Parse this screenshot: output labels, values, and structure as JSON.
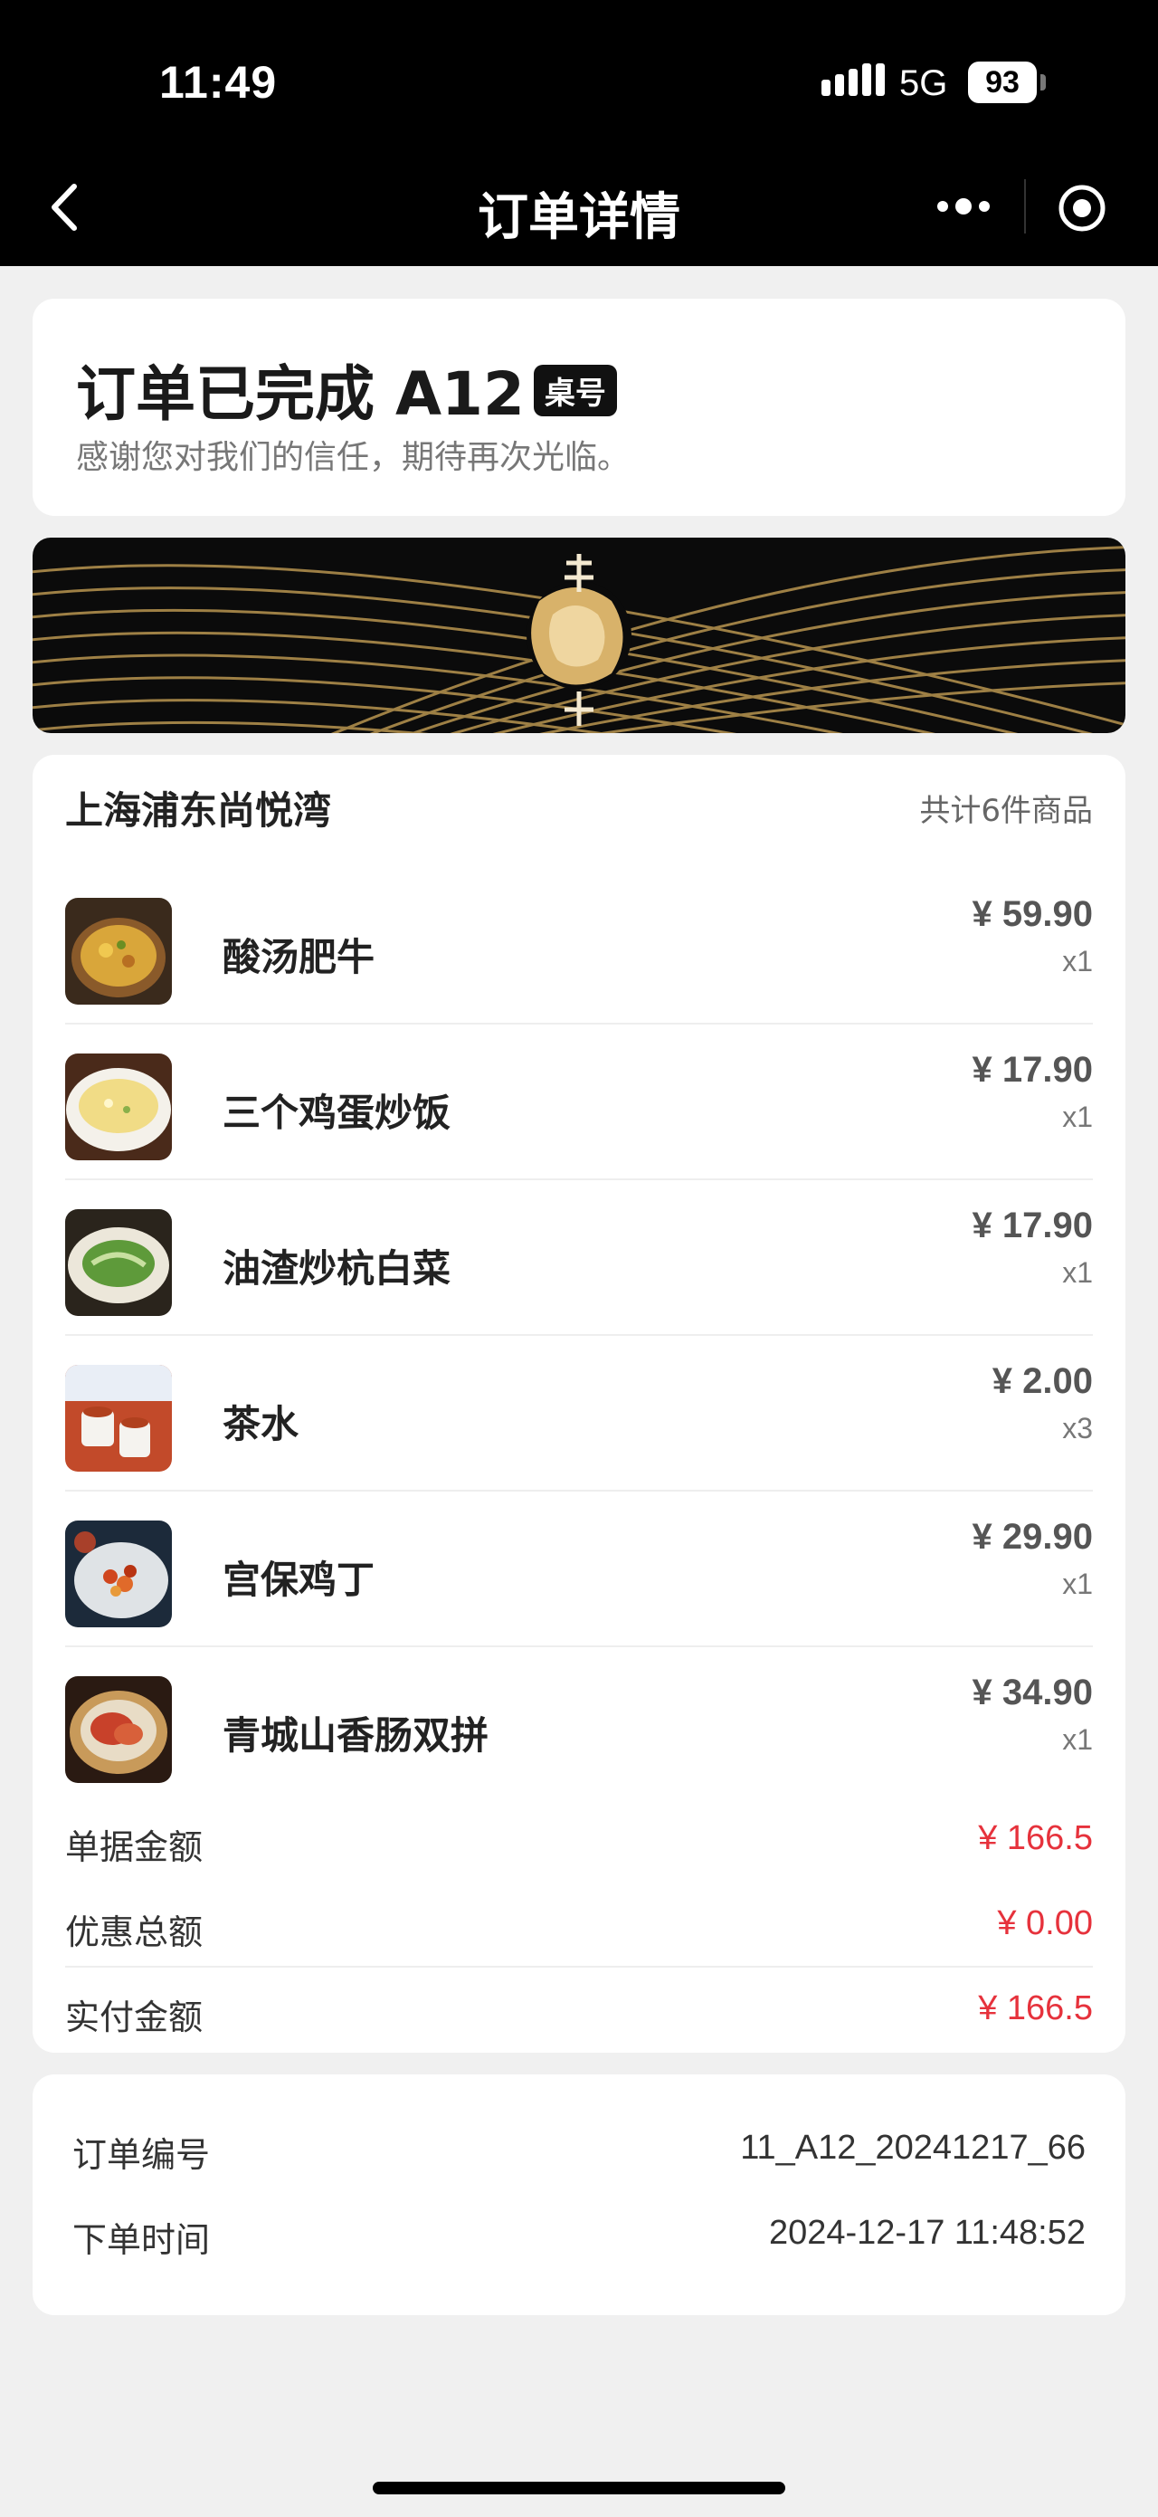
{
  "status_bar": {
    "time": "11:49",
    "network": "5G",
    "battery": "93"
  },
  "nav": {
    "title": "订单详情"
  },
  "order_status": {
    "title": "订单已完成 A12",
    "table_badge": "桌号",
    "subtitle": "感谢您对我们的信任，期待再次光临。"
  },
  "store": {
    "name": "上海浦东尚悦湾",
    "item_count": "共计6件商品"
  },
  "items": [
    {
      "name": "酸汤肥牛",
      "price": "¥ 59.90",
      "qty": "x1"
    },
    {
      "name": "三个鸡蛋炒饭",
      "price": "¥ 17.90",
      "qty": "x1"
    },
    {
      "name": "油渣炒杭白菜",
      "price": "¥ 17.90",
      "qty": "x1"
    },
    {
      "name": "茶水",
      "price": "¥ 2.00",
      "qty": "x3"
    },
    {
      "name": "宫保鸡丁",
      "price": "¥ 29.90",
      "qty": "x1"
    },
    {
      "name": "青城山香肠双拼",
      "price": "¥ 34.90",
      "qty": "x1"
    }
  ],
  "summary": {
    "bill_label": "单据金额",
    "bill_value": "¥ 166.5",
    "discount_label": "优惠总额",
    "discount_value": "¥ 0.00",
    "paid_label": "实付金额",
    "paid_value": "¥ 166.5"
  },
  "order_info": {
    "number_label": "订单编号",
    "number_value": "11_A12_20241217_66",
    "time_label": "下单时间",
    "time_value": "2024-12-17 11:48:52"
  },
  "colors": {
    "accent_red": "#e6323c",
    "header_bg": "#000000",
    "banner_gold": "#c9a45c"
  }
}
